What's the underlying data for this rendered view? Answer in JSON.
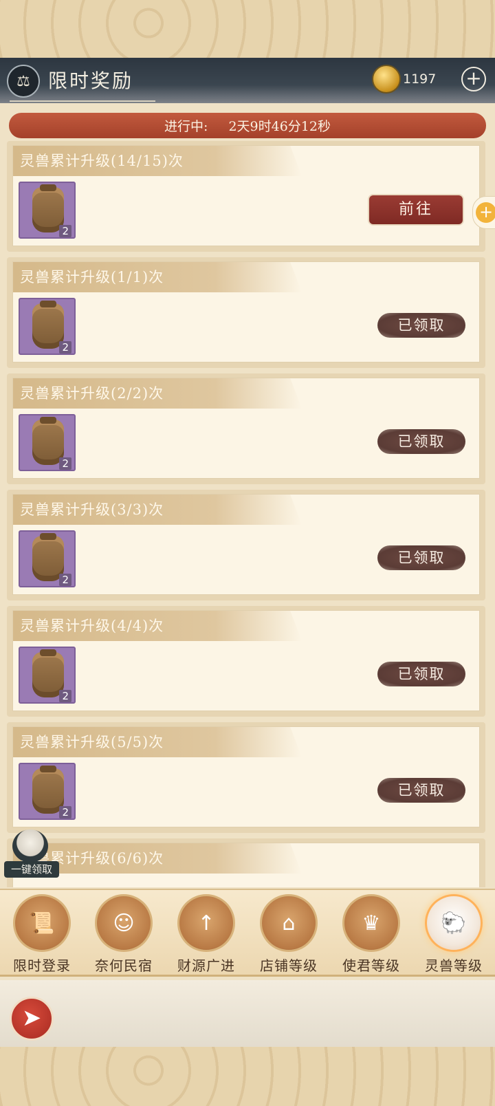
{
  "header": {
    "title": "限时奖励",
    "icon": "scale-icon",
    "currency_count": "1197",
    "plus_label": "+"
  },
  "timer": {
    "status": "进行中:",
    "remaining": "2天9时46分12秒"
  },
  "tasks": [
    {
      "title": "灵兽累计升级(14/15)次",
      "item_count": "2",
      "state": "前往"
    },
    {
      "title": "灵兽累计升级(1/1)次",
      "item_count": "2",
      "state": "已领取"
    },
    {
      "title": "灵兽累计升级(2/2)次",
      "item_count": "2",
      "state": "已领取"
    },
    {
      "title": "灵兽累计升级(3/3)次",
      "item_count": "2",
      "state": "已领取"
    },
    {
      "title": "灵兽累计升级(4/4)次",
      "item_count": "2",
      "state": "已领取"
    },
    {
      "title": "灵兽累计升级(5/5)次",
      "item_count": "2",
      "state": "已领取"
    },
    {
      "title": "灵兽累计升级(6/6)次"
    }
  ],
  "side_plus": "+",
  "onekey_label": "一键领取",
  "tabs": [
    {
      "label": "限时登录",
      "icon": "scroll-icon"
    },
    {
      "label": "奈何民宿",
      "icon": "characters-icon"
    },
    {
      "label": "财源广进",
      "icon": "wealth-icon"
    },
    {
      "label": "店铺等级",
      "icon": "shop-icon"
    },
    {
      "label": "使君等级",
      "icon": "crown-icon"
    },
    {
      "label": "灵兽等级",
      "icon": "spirit-beast-icon",
      "active": true
    }
  ],
  "colors": {
    "accent_red": "#a4412a",
    "button_red": "#8b3129",
    "claimed_badge": "#5b3c36",
    "tab_active_glow": "#ffb25a"
  }
}
